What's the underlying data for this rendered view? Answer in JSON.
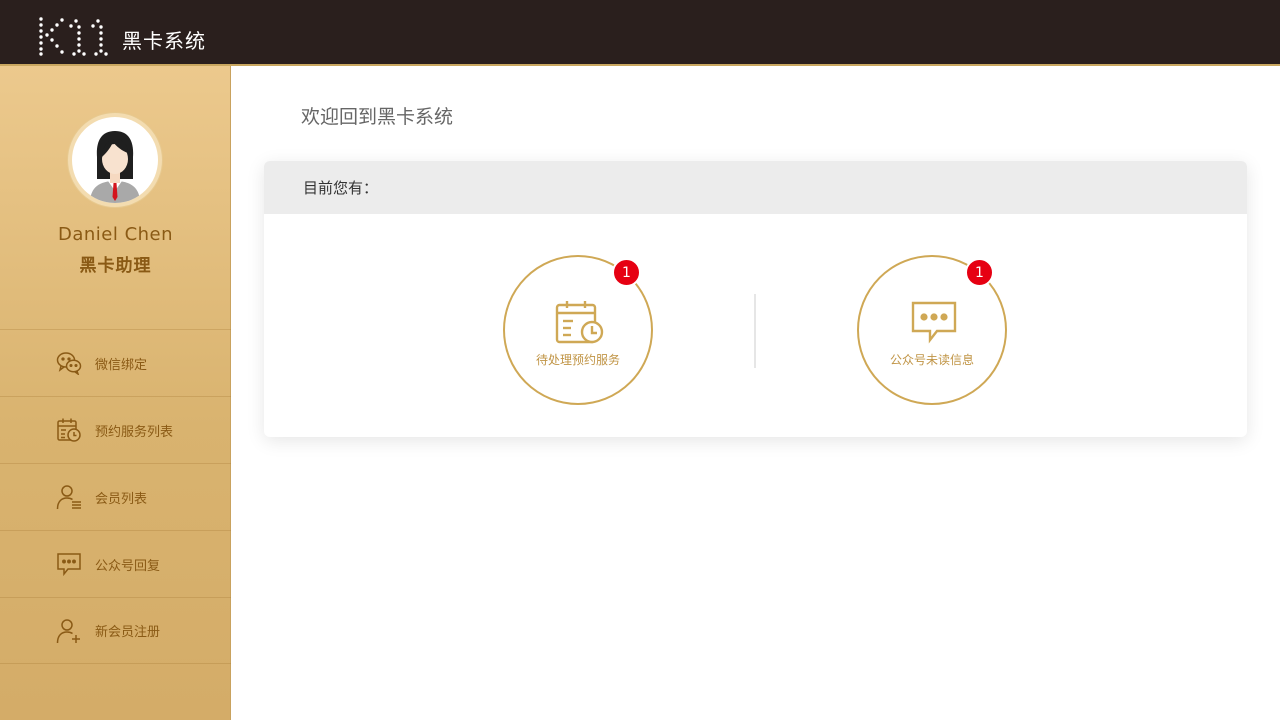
{
  "header": {
    "logo_text": "K11",
    "app_title": "黑卡系统"
  },
  "user": {
    "name": "Daniel Chen",
    "role": "黑卡助理"
  },
  "sidebar": {
    "items": [
      {
        "label": "微信绑定",
        "icon": "wechat-icon"
      },
      {
        "label": "预约服务列表",
        "icon": "calendar-clock-icon"
      },
      {
        "label": "会员列表",
        "icon": "member-list-icon"
      },
      {
        "label": "公众号回复",
        "icon": "chat-bubble-icon"
      },
      {
        "label": "新会员注册",
        "icon": "add-user-icon"
      }
    ]
  },
  "main": {
    "welcome": "欢迎回到黑卡系统",
    "panel_title": "目前您有：",
    "stats": [
      {
        "label": "待处理预约服务",
        "count": "1",
        "icon": "calendar-clock-icon"
      },
      {
        "label": "公众号未读信息",
        "count": "1",
        "icon": "chat-bubble-icon"
      }
    ]
  },
  "colors": {
    "topbar": "#2a1f1d",
    "sidebar_gold": "#dcb775",
    "accent_gold": "#cfa855",
    "menu_text": "#8a5a15",
    "badge_red": "#e60012"
  }
}
